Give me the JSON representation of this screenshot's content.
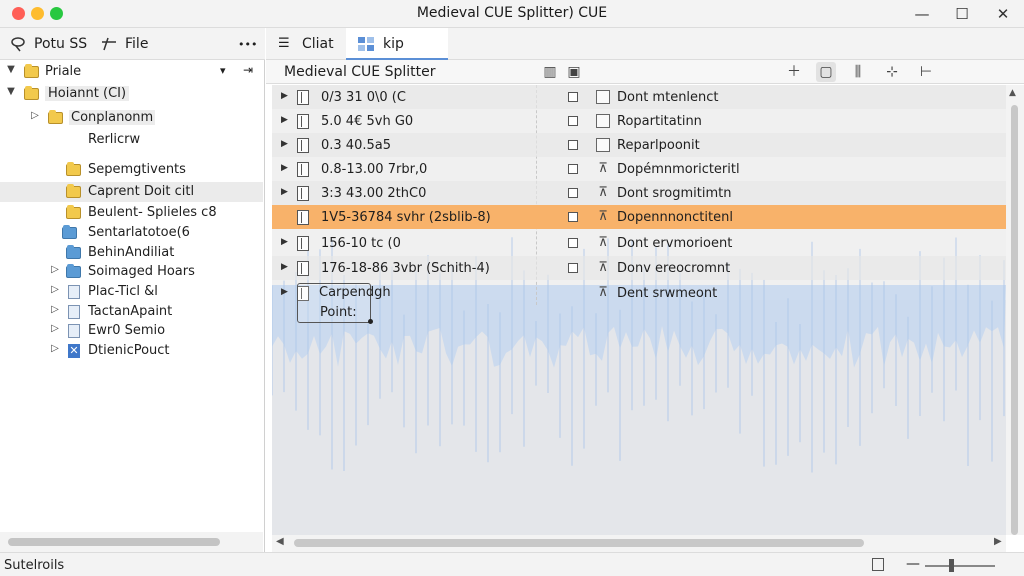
{
  "window": {
    "title": "Medieval CUE Splitter) CUE",
    "minimize": "—",
    "maximize": "☐",
    "close": "✕"
  },
  "left_header": {
    "tab1_label": "Potu SS",
    "tab2_label": "File",
    "more": "•••"
  },
  "tree": [
    {
      "label": "Priale",
      "caret": "▼",
      "icon": "folder-yellow"
    },
    {
      "label": "Hoiannt (CI)",
      "caret": "▼",
      "icon": "folder-yellow"
    },
    {
      "label": "Conplanonm",
      "caret": "▷",
      "icon": "folder-yellow"
    },
    {
      "label": "Rerlicrw",
      "caret": "",
      "icon": ""
    },
    {
      "label": "Sepemgtivents",
      "caret": "",
      "icon": "folder-yellow"
    },
    {
      "label": "Caprent Doit citl",
      "caret": "",
      "icon": "folder-yellow"
    },
    {
      "label": "Beulent- Splieles c8",
      "caret": "",
      "icon": "folder-yellow"
    },
    {
      "label": "Sentarlatotoe(6",
      "caret": "",
      "icon": "folder-blue"
    },
    {
      "label": "BehinAndiliat",
      "caret": "",
      "icon": "folder-blue"
    },
    {
      "label": "Soimaged Hoars",
      "caret": "▷",
      "icon": "folder-blue"
    },
    {
      "label": "Plac-Ticl &l",
      "caret": "▷",
      "icon": "doc"
    },
    {
      "label": "TactanApaint",
      "caret": "▷",
      "icon": "doc"
    },
    {
      "label": "Ewr0 Semio",
      "caret": "▷",
      "icon": "doc"
    },
    {
      "label": "DtienicPouct",
      "caret": "▷",
      "icon": "xfile"
    }
  ],
  "tabs": [
    {
      "label": "Cliat"
    },
    {
      "label": "kip"
    }
  ],
  "toolbar": {
    "title": "Medieval CUE Splitter"
  },
  "rows": [
    {
      "time": "0/3 31 0\\0 (C",
      "desc": "Dont mtenlenct",
      "icon": "box"
    },
    {
      "time": "5.0 4€ 5vh G0",
      "desc": "Ropartitatinn",
      "icon": "box"
    },
    {
      "time": "0.3 40.5a5",
      "desc": "Reparlpoonit",
      "icon": "box"
    },
    {
      "time": "0.8-13.00 7rbr,0",
      "desc": "Dopémnmoricteritl",
      "icon": "mark"
    },
    {
      "time": "3:3 43.00 2thC0",
      "desc": "Dont srogmitimtn",
      "icon": "mark"
    },
    {
      "time": "1V5-36784 svhr (2sblib-8)",
      "desc": "Dopennnonctitenl",
      "icon": "mark"
    },
    {
      "time": "156-10 tc (0",
      "desc": "Dont ervmorioent",
      "icon": "mark"
    },
    {
      "time": "176-18-86 3vbr (Schith-4)",
      "desc": "Donv ereocromnt",
      "icon": "mark"
    },
    {
      "time": "",
      "desc": "Dent srwmeont",
      "icon": "mark"
    }
  ],
  "callout": {
    "line1": "Carpendgh",
    "line2": "Point:"
  },
  "status": {
    "text": "Sutelroils",
    "minus": "—"
  },
  "colors": {
    "highlight": "#f8b26a",
    "waveform": "#a9c4e8",
    "accent": "#5b8fd6"
  }
}
